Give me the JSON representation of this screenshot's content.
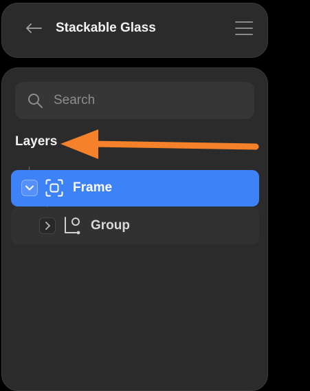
{
  "header": {
    "back_icon": "arrow-left-icon",
    "title": "Stackable Glass",
    "menu_icon": "hamburger-menu-icon"
  },
  "search": {
    "icon": "search-icon",
    "placeholder": "Search",
    "value": ""
  },
  "layers": {
    "heading": "Layers",
    "items": [
      {
        "label": "Frame",
        "icon": "frame-icon",
        "toggle_icon": "chevron-down-icon",
        "expanded": true,
        "selected": true,
        "depth": 0
      },
      {
        "label": "Group",
        "icon": "group-icon",
        "toggle_icon": "chevron-right-icon",
        "expanded": false,
        "selected": false,
        "depth": 1
      }
    ]
  },
  "annotation": {
    "type": "arrow",
    "points_to": "layers-heading",
    "color": "#f5822a"
  },
  "colors": {
    "background": "#000000",
    "panel": "#2b2b2b",
    "selected_row": "#3e82f7",
    "hover_row": "#313131",
    "search_field": "#363636"
  }
}
